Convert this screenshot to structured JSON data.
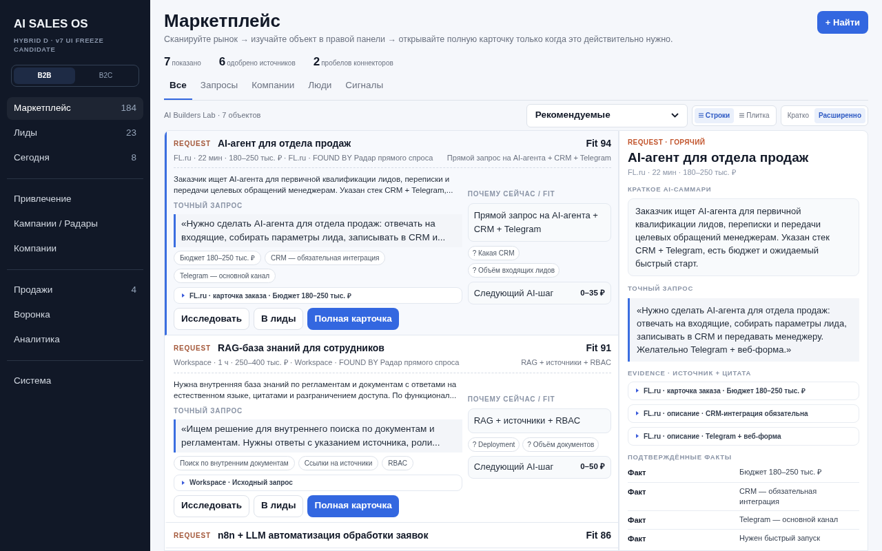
{
  "sidebar": {
    "title": "AI SALES OS",
    "subtitle": "HYBRID D · v7 UI FREEZE CANDIDATE",
    "segments": [
      {
        "label": "B2B",
        "selected": true
      },
      {
        "label": "B2C",
        "selected": false
      }
    ],
    "groups": [
      [
        {
          "label": "Маркетплейс",
          "count": "184",
          "selected": true
        },
        {
          "label": "Лиды",
          "count": "23",
          "selected": false
        },
        {
          "label": "Сегодня",
          "count": "8",
          "selected": false
        }
      ],
      [
        {
          "label": "Привлечение",
          "selected": false
        },
        {
          "label": "Кампании / Радары",
          "selected": false
        },
        {
          "label": "Компании",
          "selected": false
        }
      ],
      [
        {
          "label": "Продажи",
          "count": "4",
          "selected": false
        },
        {
          "label": "Воронка",
          "selected": false
        },
        {
          "label": "Аналитика",
          "selected": false
        }
      ],
      [
        {
          "label": "Система",
          "selected": false
        }
      ]
    ]
  },
  "header": {
    "title": "Маркетплейс",
    "subtitle": "Сканируйте рынок → изучайте объект в правой панели → открывайте полную карточку только когда это действительно нужно.",
    "find_button": "+ Найти",
    "stats": [
      {
        "value": "7",
        "label": "показано"
      },
      {
        "value": "6",
        "label": "одобрено источников"
      },
      {
        "value": "2",
        "label": "пробелов коннекторов"
      }
    ]
  },
  "tabs": [
    {
      "label": "Все",
      "selected": true
    },
    {
      "label": "Запросы",
      "selected": false
    },
    {
      "label": "Компании",
      "selected": false
    },
    {
      "label": "Люди",
      "selected": false
    },
    {
      "label": "Сигналы",
      "selected": false
    }
  ],
  "toolbar": {
    "context": "AI Builders Lab · 7 объектов",
    "sort": "Рекомендуемые",
    "view_modes": [
      {
        "label": "Строки",
        "selected": true
      },
      {
        "label": "Плитка",
        "selected": false
      }
    ],
    "density": [
      {
        "label": "Кратко",
        "selected": false
      },
      {
        "label": "Расширенно",
        "selected": true
      }
    ]
  },
  "cards": [
    {
      "type": "REQUEST",
      "title": "AI-агент для отдела продаж",
      "fit": "Fit 94",
      "selected": true,
      "meta": "FL.ru · 22 мин · 180–250 тыс. ₽ · FL.ru · FOUND BY Радар прямого спроса",
      "meta_right": "Прямой запрос на AI-агента + CRM + Telegram",
      "summary": "Заказчик ищет AI-агента для первичной квалификации лидов, переписки и передачи целевых обращений менеджерам. Указан стек CRM + Telegram,...",
      "quote_label": "ТОЧНЫЙ ЗАПРОС",
      "quote": "«Нужно сделать AI-агента для отдела продаж: отвечать на входящие, собирать параметры лида, записывать в CRM и...",
      "tags": [
        "Бюджет 180–250 тыс. ₽",
        "CRM — обязательная интеграция",
        "Telegram — основной канал"
      ],
      "evidence": "FL.ru · карточка заказа · Бюджет 180–250 тыс. ₽",
      "actions": [
        {
          "label": "Исследовать",
          "kind": "secondary"
        },
        {
          "label": "В лиды",
          "kind": "secondary"
        },
        {
          "label": "Полная карточка",
          "kind": "primary"
        }
      ],
      "why_label": "ПОЧЕМУ СЕЙЧАС / FIT",
      "why": "Прямой запрос на AI-агента + CRM + Telegram",
      "questions": [
        "? Какая CRM",
        "? Объём входящих лидов"
      ],
      "next_step": "Следующий AI-шаг",
      "next_price": "0–35 ₽"
    },
    {
      "type": "REQUEST",
      "title": "RAG-база знаний для сотрудников",
      "fit": "Fit 91",
      "selected": false,
      "meta": "Workspace · 1 ч · 250–400 тыс. ₽ · Workspace · FOUND BY Радар прямого спроса",
      "meta_right": "RAG + источники + RBAC",
      "summary": "Нужна внутренняя база знаний по регламентам и документам с ответами на естественном языке, цитатами и разграничением доступа. По функционал...",
      "quote_label": "ТОЧНЫЙ ЗАПРОС",
      "quote": "«Ищем решение для внутреннего поиска по документам и регламентам. Нужны ответы с указанием источника, роли...",
      "tags": [
        "Поиск по внутренним документам",
        "Ссылки на источники",
        "RBAC"
      ],
      "evidence": "Workspace · Исходный запрос",
      "actions": [
        {
          "label": "Исследовать",
          "kind": "secondary"
        },
        {
          "label": "В лиды",
          "kind": "secondary"
        },
        {
          "label": "Полная карточка",
          "kind": "primary"
        }
      ],
      "why_label": "ПОЧЕМУ СЕЙЧАС / FIT",
      "why": "RAG + источники + RBAC",
      "questions": [
        "? Deployment",
        "? Объём документов"
      ],
      "next_step": "Следующий AI-шаг",
      "next_price": "0–50 ₽"
    },
    {
      "type": "REQUEST",
      "title": "n8n + LLM автоматизация обработки заявок",
      "fit": "Fit 86",
      "selected": false
    }
  ],
  "detail": {
    "eyebrow": "REQUEST · ГОРЯЧИЙ",
    "title": "AI-агент для отдела продаж",
    "meta": "FL.ru · 22 мин · 180–250 тыс. ₽",
    "summary_label": "КРАТКОЕ AI-САММАРИ",
    "summary": "Заказчик ищет AI-агента для первичной квалификации лидов, переписки и передачи целевых обращений менеджерам. Указан стек CRM + Telegram, есть бюджет и ожидаемый быстрый старт.",
    "quote_label": "ТОЧНЫЙ ЗАПРОС",
    "quote": "«Нужно сделать AI-агента для отдела продаж: отвечать на входящие, собирать параметры лида, записывать в CRM и передавать менеджеру. Желательно Telegram + веб-форма.»",
    "evidence_label": "EVIDENCE · ИСТОЧНИК + ЦИТАТА",
    "evidence": [
      "FL.ru · карточка заказа · Бюджет 180–250 тыс. ₽",
      "FL.ru · описание · CRM-интеграция обязательна",
      "FL.ru · описание · Telegram + веб-форма"
    ],
    "facts_label": "ПОДТВЕРЖДЁННЫЕ ФАКТЫ",
    "facts": [
      {
        "label": "Факт",
        "value": "Бюджет 180–250 тыс. ₽"
      },
      {
        "label": "Факт",
        "value": "CRM — обязательная интеграция"
      },
      {
        "label": "Факт",
        "value": "Telegram — основной канал"
      },
      {
        "label": "Факт",
        "value": "Нужен быстрый запуск"
      }
    ]
  }
}
